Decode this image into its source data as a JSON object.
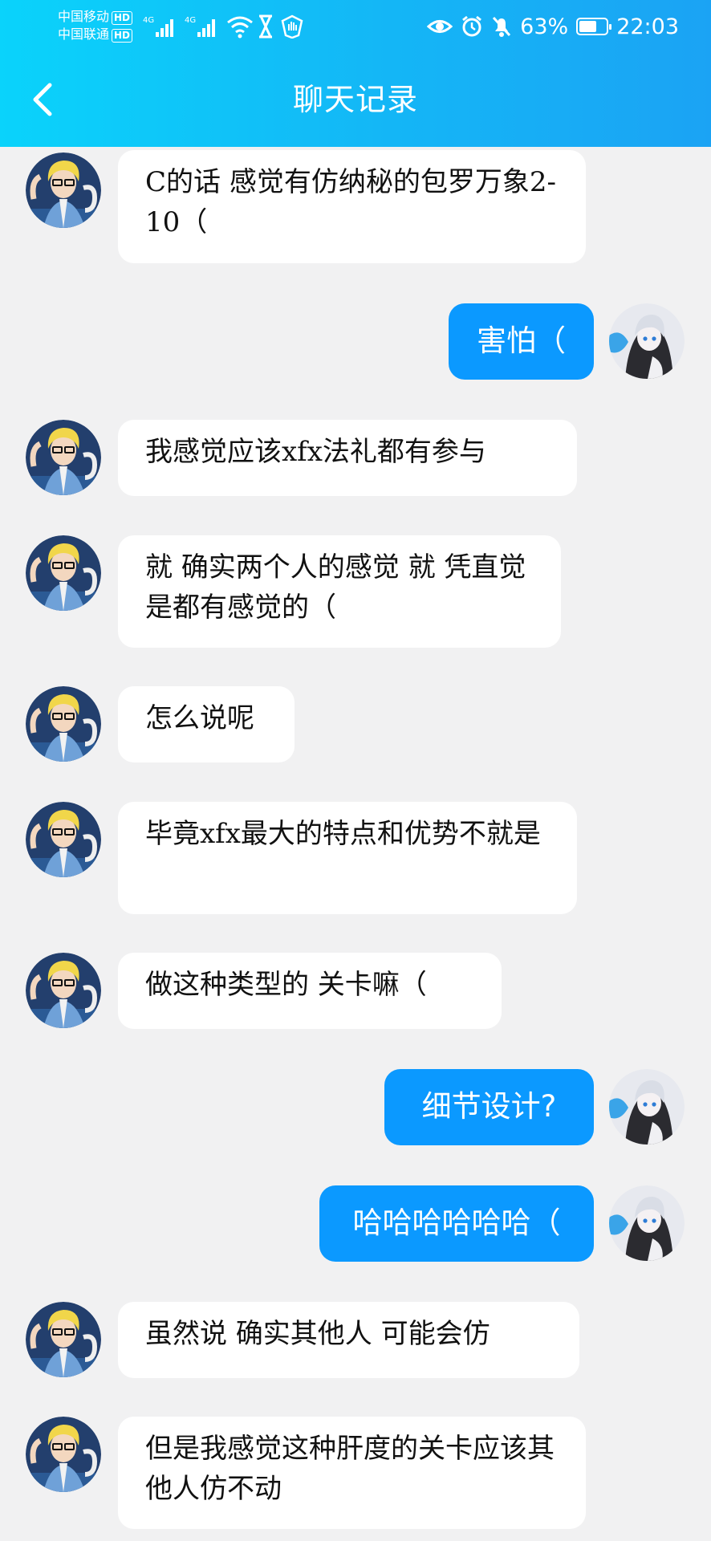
{
  "status_bar": {
    "carrier1": "中国移动",
    "carrier2": "中国联通",
    "hd": "HD",
    "net": "4G",
    "battery_percent": "63%",
    "time": "22:03"
  },
  "header": {
    "title": "聊天记录",
    "back_icon": "chevron-left-icon"
  },
  "colors": {
    "header_gradient_start": "#0ad3fb",
    "header_gradient_end": "#1ba3f4",
    "outgoing_bubble": "#0b99ff",
    "background": "#f1f1f2"
  },
  "messages": [
    {
      "side": "in",
      "text": "C的话 感觉有仿纳秘的包罗万象2-10（"
    },
    {
      "side": "out",
      "text": "害怕（"
    },
    {
      "side": "in",
      "text": "我感觉应该xfx法礼都有参与"
    },
    {
      "side": "in",
      "text": "就 确实两个人的感觉 就 凭直觉是都有感觉的（"
    },
    {
      "side": "in",
      "text": "怎么说呢"
    },
    {
      "side": "in",
      "text": "毕竟xfx最大的特点和优势不就是"
    },
    {
      "side": "in",
      "text": "做这种类型的 关卡嘛（"
    },
    {
      "side": "out",
      "text": "细节设计?"
    },
    {
      "side": "out",
      "text": "哈哈哈哈哈哈（"
    },
    {
      "side": "in",
      "text": "虽然说 确实其他人 可能会仿"
    },
    {
      "side": "in",
      "text": "但是我感觉这种肝度的关卡应该其他人仿不动"
    }
  ]
}
